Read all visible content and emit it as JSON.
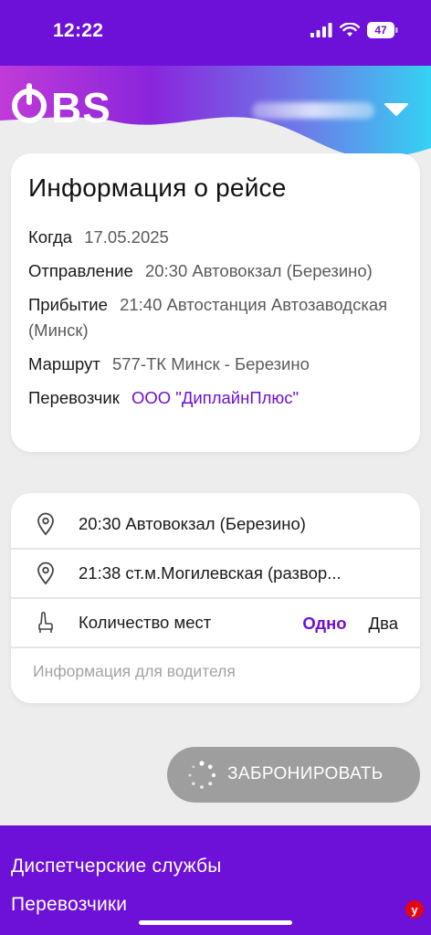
{
  "status_bar": {
    "time": "12:22",
    "battery": "47",
    "icons": [
      "signal-icon",
      "wifi-icon",
      "battery-icon"
    ]
  },
  "header": {
    "logo_text": "BS",
    "icons": [
      "power-icon",
      "chevron-down-icon"
    ]
  },
  "trip_info": {
    "title": "Информация о рейсе",
    "rows": [
      {
        "label": "Когда",
        "value": "17.05.2025"
      },
      {
        "label": "Отправление",
        "value": "20:30 Автовокзал (Березино)"
      },
      {
        "label": "Прибытие",
        "value": "21:40 Автостанция Автозаводская (Минск)"
      },
      {
        "label": "Маршрут",
        "value": "577-ТК Минск - Березино"
      },
      {
        "label": "Перевозчик",
        "value": "ООО \"ДиплайнПлюс\""
      }
    ]
  },
  "booking": {
    "from_stop": "20:30 Автовокзал (Березино)",
    "to_stop": "21:38 ст.м.Могилевская (развор...",
    "seats_label": "Количество мест",
    "seat_options": [
      "Одно",
      "Два"
    ],
    "selected_seats": "Одно",
    "driver_note_placeholder": "Информация для водителя",
    "icons": [
      "location-pin-icon",
      "location-pin-icon",
      "seat-icon"
    ]
  },
  "book_button": {
    "label": "ЗАБРОНИРОВАТЬ",
    "icon": "loading-spinner-icon"
  },
  "footer": {
    "links": [
      "Диспетчерские службы",
      "Перевозчики"
    ]
  },
  "watermark": "у",
  "colors": {
    "brand_purple": "#6d10d8",
    "wave_gradient_start": "#c03bd8",
    "wave_gradient_end": "#34d2f2",
    "button_disabled": "#9e9e9e"
  }
}
